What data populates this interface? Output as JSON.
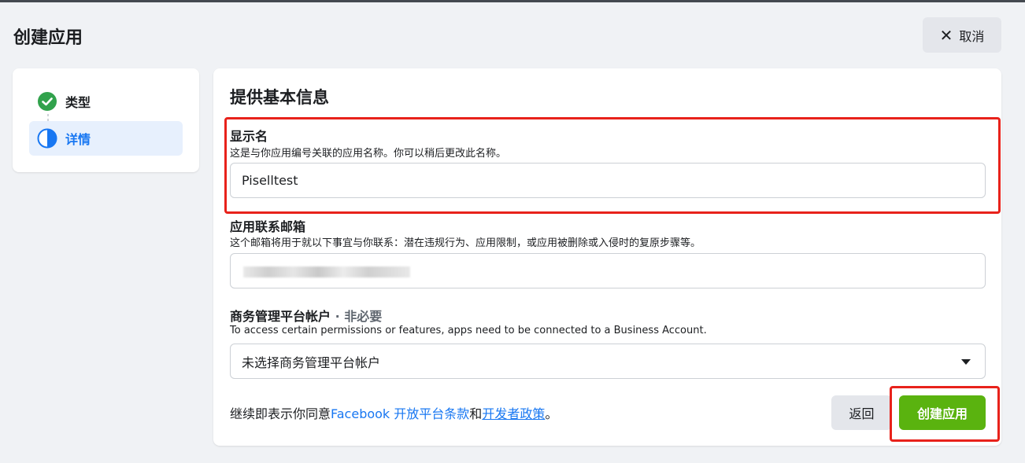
{
  "page": {
    "title": "创建应用",
    "cancel_label": "取消"
  },
  "steps": [
    {
      "label": "类型",
      "status": "done",
      "icon": "check-circle-icon"
    },
    {
      "label": "详情",
      "status": "current",
      "icon": "half-circle-icon"
    }
  ],
  "form": {
    "section_title": "提供基本信息",
    "display_name": {
      "label": "显示名",
      "help": "这是与你应用编号关联的应用名称。你可以稍后更改此名称。",
      "value": "Piselltest"
    },
    "contact_email": {
      "label": "应用联系邮箱",
      "help": "这个邮箱将用于就以下事宜与你联系：潜在违规行为、应用限制，或应用被删除或入侵时的复原步骤等。"
    },
    "business_account": {
      "label": "商务管理平台帐户",
      "optional_tag": " · 非必要",
      "help": "To access certain permissions or features, apps need to be connected to a Business Account.",
      "selected": "未选择商务管理平台帐户"
    },
    "terms": {
      "prefix": "继续即表示你同意",
      "link1": "Facebook 开放平台条款",
      "and": "和",
      "link2": "开发者政策",
      "suffix": "。"
    },
    "back_label": "返回",
    "create_label": "创建应用"
  },
  "colors": {
    "accent": "#1877f2",
    "create": "#5ab30f",
    "highlight": "#e8221b"
  }
}
